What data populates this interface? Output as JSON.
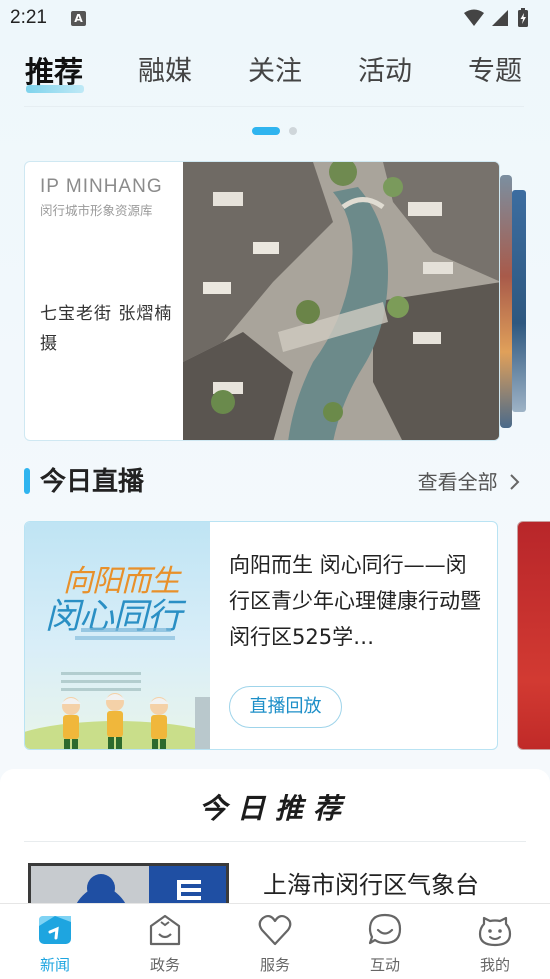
{
  "status_bar": {
    "time": "2:21",
    "notif_letter": "A"
  },
  "top_tabs": [
    {
      "label": "推荐",
      "active": true
    },
    {
      "label": "融媒",
      "active": false
    },
    {
      "label": "关注",
      "active": false
    },
    {
      "label": "活动",
      "active": false
    },
    {
      "label": "专题",
      "active": false
    }
  ],
  "carousel": {
    "page_count": 2,
    "current_page": 1
  },
  "banner": {
    "brand": "IP  MINHANG",
    "brand_sub": "闵行城市形象资源库",
    "caption": "七宝老街 张熠楠摄"
  },
  "live_section": {
    "title": "今日直播",
    "see_all": "查看全部",
    "card": {
      "poster_title_1": "向阳而生",
      "poster_title_2": "闵心同行",
      "title": "向阳而生 闵心同行——闵行区青少年心理健康行动暨闵行区525学…",
      "button": "直播回放"
    }
  },
  "recommend": {
    "title": "今日推荐",
    "items": [
      {
        "title": "上海市闵行区气象台"
      }
    ]
  },
  "bottom_nav": [
    {
      "label": "新闻",
      "active": true,
      "icon": "news-icon"
    },
    {
      "label": "政务",
      "active": false,
      "icon": "government-icon"
    },
    {
      "label": "服务",
      "active": false,
      "icon": "heart-icon"
    },
    {
      "label": "互动",
      "active": false,
      "icon": "chat-icon"
    },
    {
      "label": "我的",
      "active": false,
      "icon": "profile-icon"
    }
  ],
  "colors": {
    "accent": "#2fb4ef",
    "active_nav": "#1ea5e0"
  }
}
